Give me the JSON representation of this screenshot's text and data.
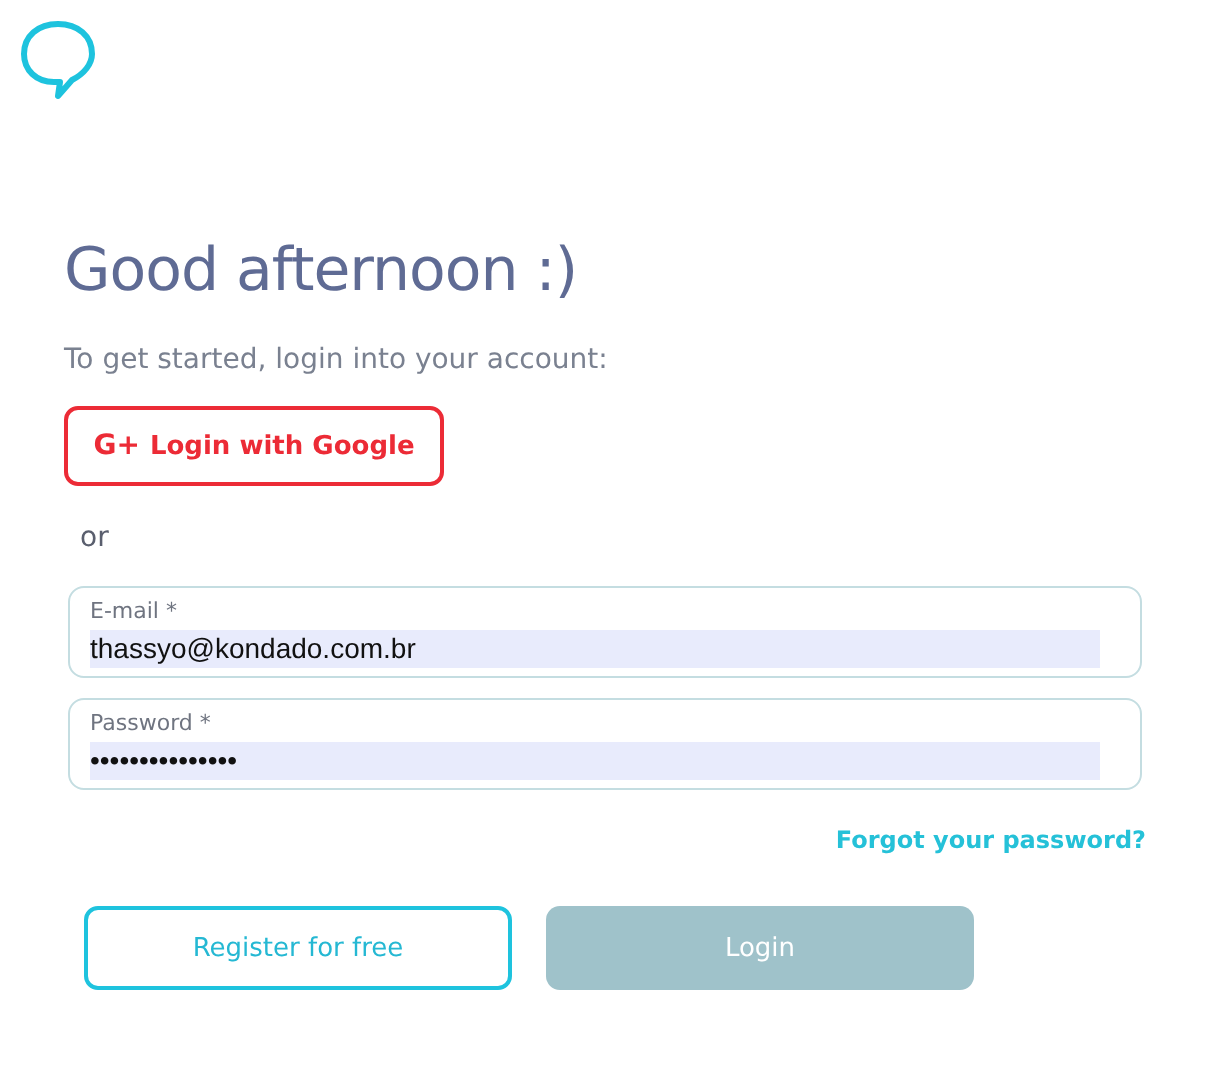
{
  "heading": "Good afternoon :)",
  "subtitle": "To get started, login into your account:",
  "google_button": {
    "icon_text": "G+",
    "label": "Login with Google"
  },
  "separator": "or",
  "fields": [
    {
      "label": "E-mail *",
      "value": "thassyo@kondado.com.br"
    },
    {
      "label": "Password *",
      "value": "•••••••••••••••"
    }
  ],
  "forgot_link": "Forgot your password?",
  "buttons": [
    {
      "label": "Register for free",
      "kind": "outline",
      "disabled": false
    },
    {
      "label": "Login",
      "kind": "primary",
      "disabled": true
    }
  ]
}
